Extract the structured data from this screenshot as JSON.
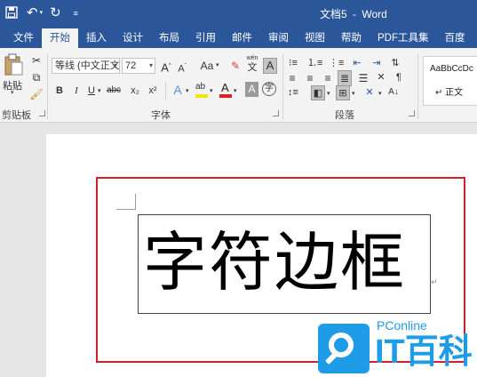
{
  "window": {
    "title": "文档5 - Word",
    "title_doc": "文档5",
    "title_sep": "-",
    "title_app": "Word"
  },
  "quick_access": {
    "save_icon": "save-icon",
    "undo_icon": "undo-icon",
    "redo_icon": "redo-icon",
    "customize_icon": "customize-qat-icon"
  },
  "tabs": [
    {
      "label": "文件",
      "active": false
    },
    {
      "label": "开始",
      "active": true
    },
    {
      "label": "插入",
      "active": false
    },
    {
      "label": "设计",
      "active": false
    },
    {
      "label": "布局",
      "active": false
    },
    {
      "label": "引用",
      "active": false
    },
    {
      "label": "邮件",
      "active": false
    },
    {
      "label": "审阅",
      "active": false
    },
    {
      "label": "视图",
      "active": false
    },
    {
      "label": "帮助",
      "active": false
    },
    {
      "label": "PDF工具集",
      "active": false
    },
    {
      "label": "百度",
      "active": false
    }
  ],
  "ribbon": {
    "clipboard": {
      "label": "剪贴板",
      "paste_label": "粘贴"
    },
    "font": {
      "label": "字体",
      "font_name": "等线 (中文正文)",
      "font_size": "72",
      "grow_glyph": "A",
      "shrink_glyph": "A",
      "case_glyph": "Aa",
      "phonetic_top": "wén",
      "phonetic_bottom": "文",
      "bold": "B",
      "italic": "I",
      "underline": "U",
      "strike": "abc",
      "subscript": "x₂",
      "superscript": "x²",
      "effects_glyph": "A",
      "highlight_glyph": "ab",
      "font_color_glyph": "A",
      "shading_glyph": "A",
      "enclose_glyph": "字",
      "border_glyph": "A"
    },
    "paragraph": {
      "label": "段落"
    },
    "styles": {
      "sample": "AaBbCcDc",
      "name": "↵ 正文"
    }
  },
  "document": {
    "text": "字符边框",
    "paragraph_mark": "↵"
  },
  "watermark": {
    "site": "PConline",
    "brand": "IT百科"
  },
  "colors": {
    "accent": "#2b579a",
    "page_border": "#cc2127",
    "watermark": "#1e9ce8",
    "font_color_bar": "#e02020",
    "highlight_bar": "#f5e400"
  }
}
